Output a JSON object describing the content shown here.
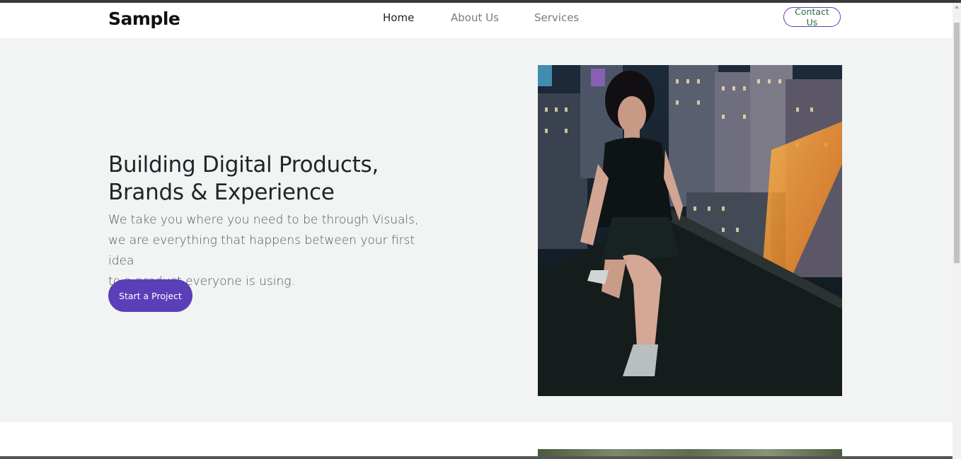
{
  "navbar": {
    "brand": "Sample",
    "links": [
      {
        "label": "Home",
        "active": true
      },
      {
        "label": "About Us",
        "active": false
      },
      {
        "label": "Services",
        "active": false
      }
    ],
    "contact_label": "Contact Us"
  },
  "hero": {
    "title_line1": "Building Digital Products,",
    "title_line2": "Brands & Experience",
    "desc_line1": "We take you where you need to be through Visuals,",
    "desc_line2": "we are everything that happens between your first idea",
    "desc_line3": "to a product everyone is using.",
    "cta_label": "Start a Project"
  },
  "colors": {
    "accent": "#5a3fb8",
    "hero_bg": "#f1f4f3",
    "text_dark": "#212529"
  }
}
